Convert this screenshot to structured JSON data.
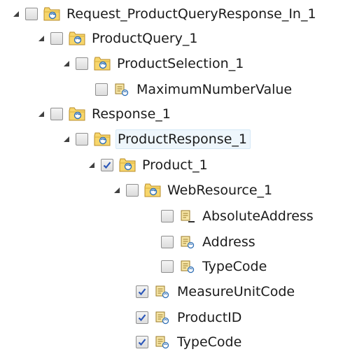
{
  "tree": {
    "nodes": [
      {
        "label": "Request_ProductQueryResponse_In_1",
        "kind": "folder",
        "expanded": true,
        "checked": false,
        "selected": false
      },
      {
        "label": "ProductQuery_1",
        "kind": "folder",
        "expanded": true,
        "checked": false,
        "selected": false
      },
      {
        "label": "ProductSelection_1",
        "kind": "folder",
        "expanded": true,
        "checked": false,
        "selected": false
      },
      {
        "label": "MaximumNumberValue",
        "kind": "field",
        "expanded": false,
        "checked": false,
        "selected": false
      },
      {
        "label": "Response_1",
        "kind": "folder",
        "expanded": true,
        "checked": false,
        "selected": false
      },
      {
        "label": "ProductResponse_1",
        "kind": "folder",
        "expanded": true,
        "checked": false,
        "selected": true
      },
      {
        "label": "Product_1",
        "kind": "folder",
        "expanded": true,
        "checked": true,
        "selected": false
      },
      {
        "label": "WebResource_1",
        "kind": "folder",
        "expanded": true,
        "checked": false,
        "selected": false
      },
      {
        "label": "AbsoluteAddress",
        "kind": "field-key",
        "expanded": false,
        "checked": false,
        "selected": false
      },
      {
        "label": "Address",
        "kind": "field",
        "expanded": false,
        "checked": false,
        "selected": false
      },
      {
        "label": "TypeCode",
        "kind": "field",
        "expanded": false,
        "checked": false,
        "selected": false
      },
      {
        "label": "MeasureUnitCode",
        "kind": "field",
        "expanded": false,
        "checked": true,
        "selected": false
      },
      {
        "label": "ProductID",
        "kind": "field",
        "expanded": false,
        "checked": true,
        "selected": false
      },
      {
        "label": "TypeCode",
        "kind": "field",
        "expanded": false,
        "checked": true,
        "selected": false
      }
    ]
  }
}
